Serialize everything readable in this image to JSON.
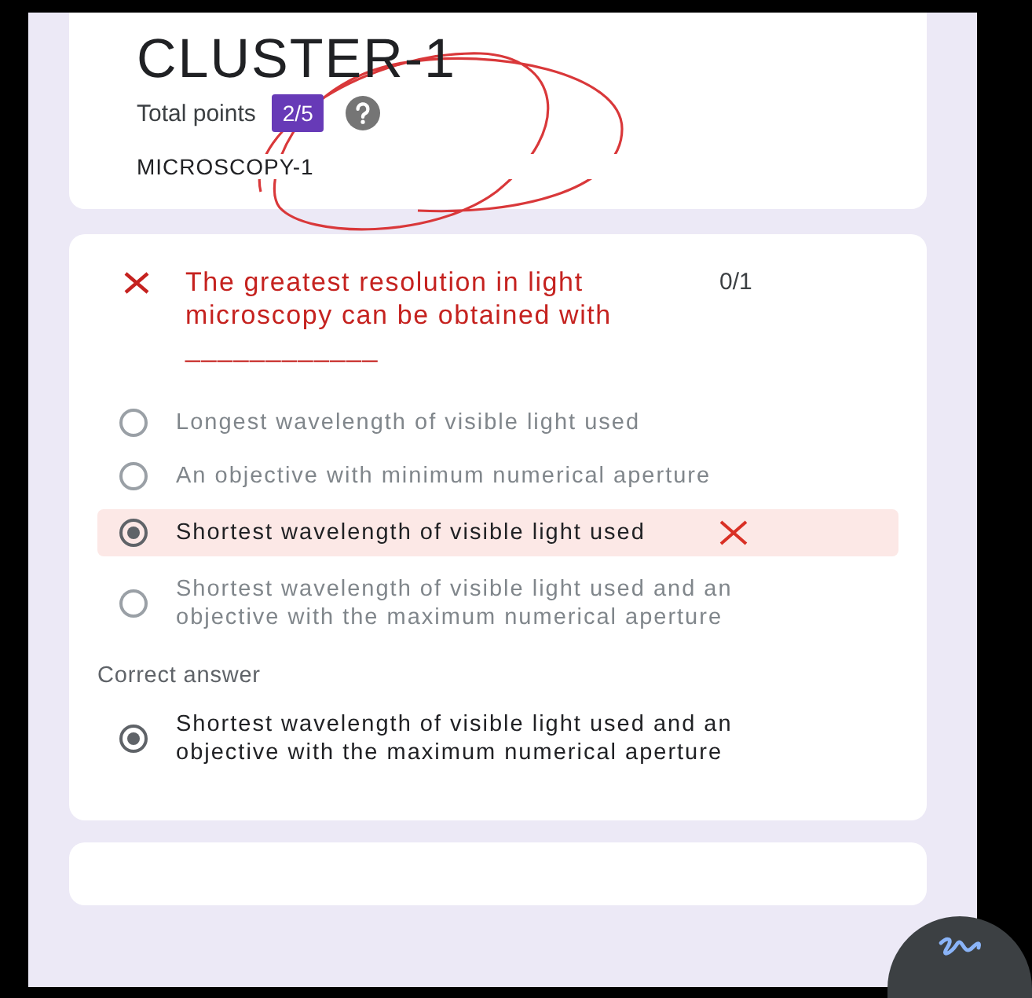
{
  "header": {
    "title": "CLUSTER-1",
    "total_points_label": "Total points",
    "score": "2/5",
    "section": "MICROSCOPY-1"
  },
  "question": {
    "correct": false,
    "text": "The greatest resolution in light microscopy can be obtained with ____________",
    "points": "0/1",
    "options": [
      {
        "text": "Longest wavelength of visible light used",
        "selected": false
      },
      {
        "text": "An objective with minimum numerical aperture",
        "selected": false
      },
      {
        "text": "Shortest wavelength of visible light used",
        "selected": true
      },
      {
        "text": "Shortest wavelength of visible light used and an objective with the maximum numerical aperture",
        "selected": false
      }
    ],
    "correct_label": "Correct answer",
    "correct_options": [
      {
        "text": "Shortest wavelength of visible light used and an objective with the maximum numerical aperture",
        "selected": true
      }
    ]
  }
}
